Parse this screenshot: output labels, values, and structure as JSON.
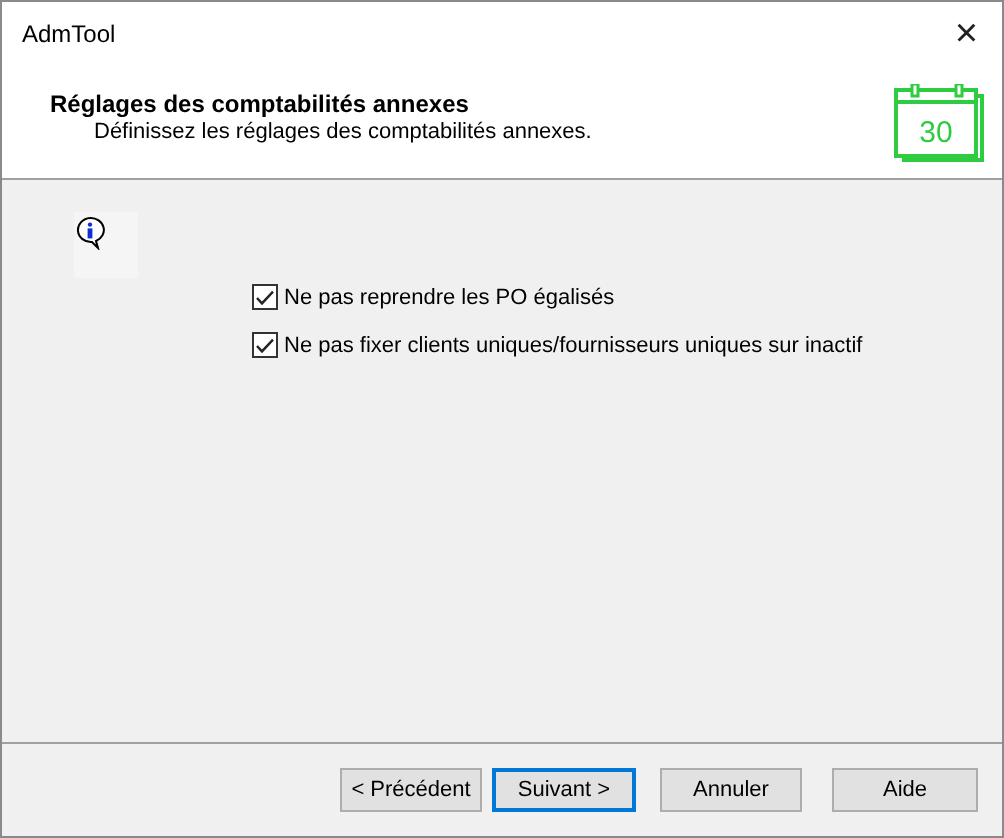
{
  "window": {
    "title": "AdmTool",
    "close": "×"
  },
  "header": {
    "title": "Réglages des comptabilités annexes",
    "subtitle": "Définissez les réglages des comptabilités annexes.",
    "calendar_day": "30"
  },
  "options": [
    {
      "label": "Ne pas reprendre les PO égalisés",
      "checked": true
    },
    {
      "label": "Ne pas fixer clients uniques/fournisseurs uniques sur inactif",
      "checked": true
    }
  ],
  "buttons": [
    {
      "label": "< Précédent",
      "default": false
    },
    {
      "label": "Suivant >",
      "default": true
    },
    {
      "label": "Annuler",
      "default": false
    },
    {
      "label": "Aide",
      "default": false
    }
  ]
}
